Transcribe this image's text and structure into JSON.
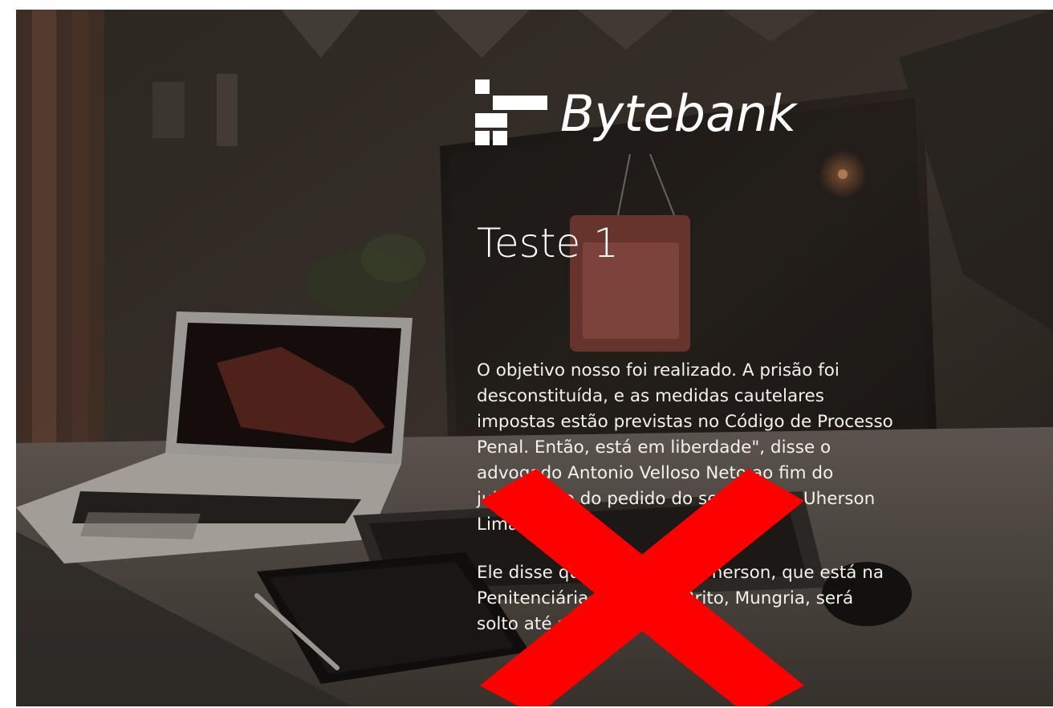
{
  "brand": {
    "name": "Bytebank",
    "logo_icon": "bytebank-logo-mark"
  },
  "content": {
    "title": "Teste 1",
    "paragraphs": [
      "O objetivo nosso foi realizado. A prisão foi desconstituída, e as medidas cautelares impostas estão previstas no Código de Processo Penal. Então, está em liberdade\", disse o advogado Antonio Velloso Neto ao fim do julgamento do pedido do seu cliente, Uherson Lima.",
      "Ele disse que o educador Uherson, que está na Penitenciária Lemos de Brito, Mungria, será solto até sexta-feira."
    ]
  },
  "overlay": {
    "icon": "red-x-icon",
    "color": "#ff0000"
  }
}
